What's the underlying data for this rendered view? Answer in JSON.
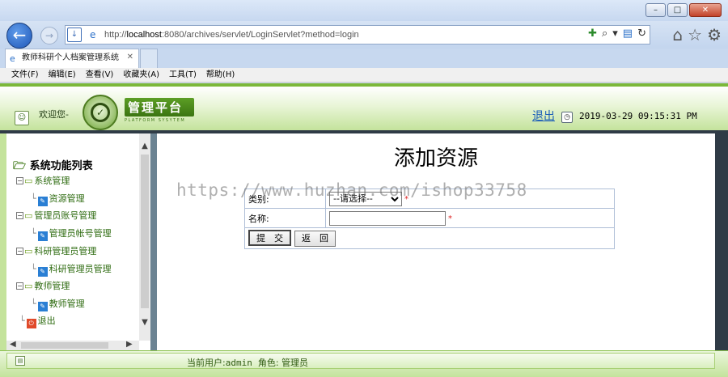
{
  "browser": {
    "url_prefix": "http://",
    "url_host": "localhost",
    "url_rest": ":8080/archives/servlet/LoginServlet?method=login",
    "tab_title": "教师科研个人档案管理系统",
    "menu": [
      "文件(F)",
      "编辑(E)",
      "查看(V)",
      "收藏夹(A)",
      "工具(T)",
      "帮助(H)"
    ]
  },
  "header": {
    "welcome": "欢迎您-",
    "logo_title": "管理平台",
    "logo_subtitle": "PLATFORM SYSYTEM",
    "logout": "退出",
    "datetime": "2019-03-29 09:15:31 PM"
  },
  "sidebar": {
    "title": "系统功能列表",
    "items": [
      {
        "label": "系统管理",
        "level": 0
      },
      {
        "label": "资源管理",
        "level": 1
      },
      {
        "label": "管理员账号管理",
        "level": 0
      },
      {
        "label": "管理员帐号管理",
        "level": 1
      },
      {
        "label": "科研管理员管理",
        "level": 0
      },
      {
        "label": "科研管理员管理",
        "level": 1
      },
      {
        "label": "教师管理",
        "level": 0
      },
      {
        "label": "教师管理",
        "level": 1
      },
      {
        "label": "退出",
        "level": 0
      }
    ]
  },
  "form": {
    "title": "添加资源",
    "type_label": "类别:",
    "type_selected": "--请选择--",
    "name_label": "名称:",
    "name_value": "",
    "required_mark": "*",
    "submit": "提　交",
    "back": "返　回"
  },
  "watermark": "https://www.huzhan.com/ishop33758",
  "status": {
    "user_label": "当前用户:",
    "user_value": "admin",
    "role_label": "角色:",
    "role_value": "管理员"
  }
}
